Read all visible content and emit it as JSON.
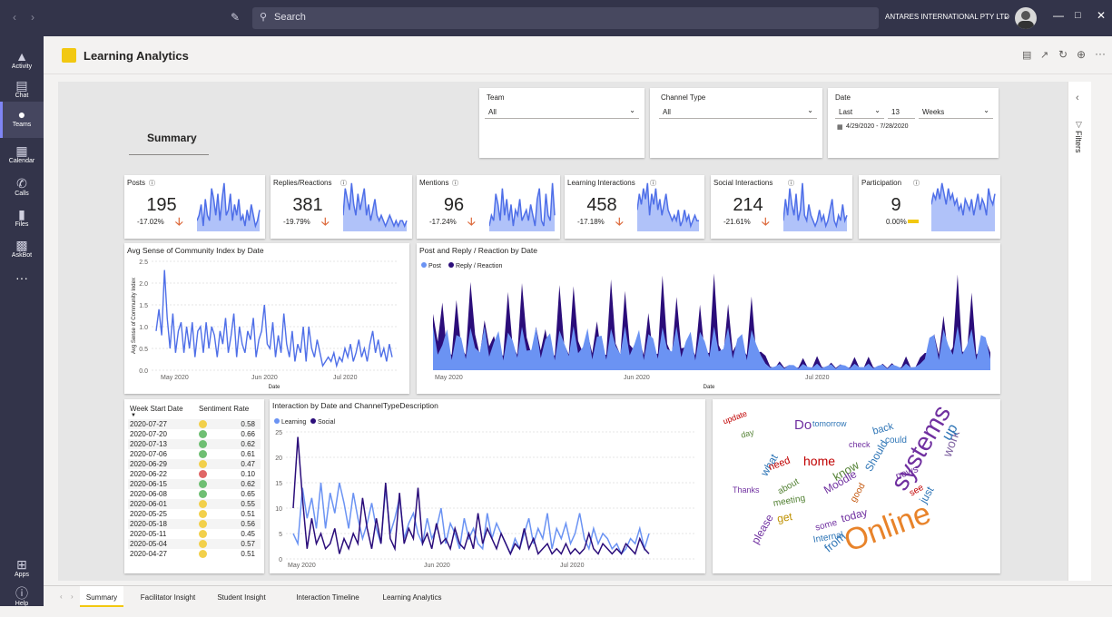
{
  "topbar": {
    "search_placeholder": "Search",
    "org": "ANTARES INTERNATIONAL PTY LTD"
  },
  "rail": [
    {
      "label": "Activity",
      "icon": "bell-icon"
    },
    {
      "label": "Chat",
      "icon": "chat-icon"
    },
    {
      "label": "Teams",
      "icon": "teams-icon"
    },
    {
      "label": "Calendar",
      "icon": "calendar-icon"
    },
    {
      "label": "Calls",
      "icon": "phone-icon"
    },
    {
      "label": "Files",
      "icon": "files-icon"
    },
    {
      "label": "AskBot",
      "icon": "bot-icon"
    }
  ],
  "rail_bottom": {
    "apps": "Apps",
    "help": "Help"
  },
  "app": {
    "title": "Learning Analytics"
  },
  "report": {
    "summary_title": "Summary",
    "filters_label": "Filters",
    "slicers": {
      "team": {
        "label": "Team",
        "value": "All"
      },
      "channel": {
        "label": "Channel Type",
        "value": "All"
      },
      "date": {
        "label": "Date",
        "period": "Last",
        "count": "13",
        "unit": "Weeks",
        "range": "4/29/2020 - 7/28/2020"
      }
    },
    "kpis": [
      {
        "title": "Posts",
        "value": "195",
        "change": "-17.02%",
        "trend": "down"
      },
      {
        "title": "Replies/Reactions",
        "value": "381",
        "change": "-19.79%",
        "trend": "down"
      },
      {
        "title": "Mentions",
        "value": "96",
        "change": "-17.24%",
        "trend": "down"
      },
      {
        "title": "Learning Interactions",
        "value": "458",
        "change": "-17.18%",
        "trend": "down"
      },
      {
        "title": "Social Interactions",
        "value": "214",
        "change": "-21.61%",
        "trend": "down"
      },
      {
        "title": "Participation",
        "value": "9",
        "change": "0.00%",
        "trend": "flat"
      }
    ],
    "sentiment_table": {
      "headers": [
        "Week Start Date",
        "Sentiment Rate"
      ],
      "rows": [
        {
          "date": "2020-07-27",
          "rate": "0.58",
          "status": "yellow"
        },
        {
          "date": "2020-07-20",
          "rate": "0.66",
          "status": "green"
        },
        {
          "date": "2020-07-13",
          "rate": "0.62",
          "status": "green"
        },
        {
          "date": "2020-07-06",
          "rate": "0.61",
          "status": "green"
        },
        {
          "date": "2020-06-29",
          "rate": "0.47",
          "status": "yellow"
        },
        {
          "date": "2020-06-22",
          "rate": "0.10",
          "status": "red"
        },
        {
          "date": "2020-06-15",
          "rate": "0.62",
          "status": "green"
        },
        {
          "date": "2020-06-08",
          "rate": "0.65",
          "status": "green"
        },
        {
          "date": "2020-06-01",
          "rate": "0.55",
          "status": "yellow"
        },
        {
          "date": "2020-05-25",
          "rate": "0.51",
          "status": "yellow"
        },
        {
          "date": "2020-05-18",
          "rate": "0.56",
          "status": "yellow"
        },
        {
          "date": "2020-05-11",
          "rate": "0.45",
          "status": "yellow"
        },
        {
          "date": "2020-05-04",
          "rate": "0.57",
          "status": "yellow"
        },
        {
          "date": "2020-04-27",
          "rate": "0.51",
          "status": "yellow"
        }
      ]
    },
    "tabs": [
      "Summary",
      "Facilitator Insight",
      "Student Insight",
      "Interaction Timeline",
      "Learning Analytics"
    ],
    "wordcloud": [
      {
        "w": "Online",
        "c": "#e8832a"
      },
      {
        "w": "systems",
        "c": "#7030a0"
      },
      {
        "w": "work",
        "c": "#8064a2"
      },
      {
        "w": "from",
        "c": "#2e75b6"
      },
      {
        "w": "home",
        "c": "#c00000"
      },
      {
        "w": "know",
        "c": "#548235"
      },
      {
        "w": "Do",
        "c": "#7030a0"
      },
      {
        "w": "up",
        "c": "#2e75b6"
      },
      {
        "w": "Moodle",
        "c": "#7030a0"
      },
      {
        "w": "get",
        "c": "#bf9000"
      },
      {
        "w": "today",
        "c": "#7030a0"
      },
      {
        "w": "what",
        "c": "#2e75b6"
      },
      {
        "w": "please",
        "c": "#7030a0"
      },
      {
        "w": "need",
        "c": "#c00000"
      },
      {
        "w": "just",
        "c": "#2e75b6"
      },
      {
        "w": "some",
        "c": "#7030a0"
      },
      {
        "w": "meeting",
        "c": "#548235"
      },
      {
        "w": "back",
        "c": "#2e75b6"
      },
      {
        "w": "news",
        "c": "#7030a0"
      },
      {
        "w": "Should",
        "c": "#2e75b6"
      },
      {
        "w": "could",
        "c": "#2e75b6"
      },
      {
        "w": "good",
        "c": "#c55a11"
      },
      {
        "w": "about",
        "c": "#548235"
      },
      {
        "w": "Internal",
        "c": "#2e75b6"
      },
      {
        "w": "update",
        "c": "#c00000"
      },
      {
        "w": "check",
        "c": "#7030a0"
      },
      {
        "w": "tomorrow",
        "c": "#2e75b6"
      },
      {
        "w": "Thanks",
        "c": "#7030a0"
      },
      {
        "w": "see",
        "c": "#c00000"
      },
      {
        "w": "day",
        "c": "#548235"
      }
    ]
  },
  "chart_data": [
    {
      "type": "area",
      "id": "posts",
      "title": "Posts",
      "values": [
        2,
        3,
        5,
        1,
        6,
        3,
        2,
        8,
        6,
        3,
        7,
        2,
        6,
        9,
        3,
        4,
        7,
        2,
        5,
        3,
        6,
        2,
        3,
        1,
        4,
        2,
        5,
        3,
        1,
        2,
        4
      ]
    },
    {
      "type": "area",
      "id": "replies",
      "title": "Replies/Reactions",
      "values": [
        3,
        8,
        6,
        4,
        9,
        5,
        3,
        7,
        4,
        6,
        8,
        3,
        5,
        2,
        4,
        6,
        3,
        2,
        3,
        2,
        1,
        2,
        3,
        2,
        1,
        2,
        1,
        2,
        2,
        1,
        2
      ]
    },
    {
      "type": "area",
      "id": "mentions",
      "title": "Mentions",
      "values": [
        1,
        3,
        2,
        7,
        5,
        2,
        8,
        3,
        6,
        2,
        5,
        1,
        4,
        3,
        6,
        2,
        3,
        4,
        2,
        5,
        3,
        1,
        6,
        8,
        2,
        1,
        7,
        3,
        2,
        9,
        3
      ]
    },
    {
      "type": "area",
      "id": "learning",
      "title": "Learning Interactions",
      "values": [
        4,
        7,
        5,
        8,
        6,
        9,
        3,
        7,
        5,
        8,
        4,
        6,
        3,
        5,
        7,
        4,
        3,
        2,
        3,
        2,
        4,
        1,
        2,
        4,
        2,
        3,
        1,
        2,
        3,
        2,
        2
      ]
    },
    {
      "type": "area",
      "id": "social",
      "title": "Social Interactions",
      "values": [
        2,
        6,
        3,
        8,
        5,
        3,
        7,
        2,
        4,
        9,
        3,
        2,
        5,
        3,
        2,
        1,
        2,
        4,
        2,
        3,
        1,
        2,
        4,
        6,
        2,
        1,
        3,
        2,
        5,
        2,
        3
      ]
    },
    {
      "type": "area",
      "id": "participation",
      "title": "Participation",
      "values": [
        5,
        7,
        6,
        8,
        6,
        9,
        7,
        5,
        8,
        6,
        7,
        5,
        6,
        4,
        5,
        3,
        6,
        5,
        4,
        6,
        3,
        5,
        7,
        4,
        6,
        5,
        3,
        8,
        6,
        5,
        7
      ]
    },
    {
      "type": "line",
      "id": "community",
      "title": "Avg Sense of Community Index by Date",
      "xlabel": "Date",
      "ylabel": "Avg Sense of Community Index",
      "ylim": [
        0,
        2.5
      ],
      "yticks": [
        "0.0",
        "0.5",
        "1.0",
        "1.5",
        "2.0",
        "2.5"
      ],
      "xticks": [
        "May 2020",
        "Jun 2020",
        "Jul 2020"
      ],
      "values": [
        0.9,
        1.4,
        0.8,
        2.3,
        1.2,
        0.5,
        1.3,
        0.4,
        0.9,
        1.1,
        0.4,
        1.0,
        0.5,
        1.1,
        0.3,
        0.9,
        1.0,
        0.4,
        1.1,
        0.5,
        1.0,
        0.8,
        0.3,
        0.9,
        0.6,
        1.2,
        0.4,
        0.8,
        1.3,
        0.3,
        1.0,
        0.6,
        0.4,
        0.9,
        0.7,
        1.2,
        0.3,
        0.7,
        0.9,
        1.5,
        0.6,
        0.5,
        1.1,
        0.3,
        0.8,
        0.4,
        1.3,
        0.6,
        0.3,
        0.9,
        0.2,
        0.6,
        0.4,
        1.0,
        0.2,
        1.0,
        0.5,
        0.3,
        0.7,
        0.4,
        0.1,
        0.2,
        0.3,
        0.2,
        0.4,
        0.1,
        0.3,
        0.2,
        0.5,
        0.3,
        0.6,
        0.2,
        0.4,
        0.7,
        0.3,
        0.5,
        0.2,
        0.6,
        0.9,
        0.4,
        0.7,
        0.3,
        0.5,
        0.2,
        0.6,
        0.3
      ]
    },
    {
      "type": "area",
      "id": "postreply",
      "title": "Post and Reply / Reaction by Date",
      "xlabel": "Date",
      "xticks": [
        "May 2020",
        "Jun 2020",
        "Jul 2020"
      ],
      "series": [
        {
          "name": "Post",
          "color": "#6b93f3"
        },
        {
          "name": "Reply / Reaction",
          "color": "#2b0d7a"
        }
      ]
    },
    {
      "type": "line",
      "id": "interaction",
      "title": "Interaction by Date and ChannelTypeDescription",
      "ylim": [
        0,
        25
      ],
      "yticks": [
        "0",
        "5",
        "10",
        "15",
        "20",
        "25"
      ],
      "xticks": [
        "May 2020",
        "Jun 2020",
        "Jul 2020"
      ],
      "series": [
        {
          "name": "Learning",
          "color": "#6b93f3",
          "values": [
            5,
            3,
            14,
            8,
            12,
            6,
            15,
            6,
            13,
            9,
            15,
            11,
            6,
            13,
            8,
            4,
            7,
            11,
            6,
            3,
            14,
            5,
            8,
            12,
            4,
            7,
            9,
            5,
            3,
            8,
            4,
            6,
            10,
            3,
            7,
            5,
            2,
            8,
            4,
            6,
            3,
            2,
            9,
            4,
            7,
            5,
            3,
            1,
            4,
            2,
            5,
            8,
            3,
            6,
            4,
            9,
            2,
            6,
            4,
            7,
            3,
            5,
            9,
            4,
            2,
            6,
            3,
            5,
            4,
            2,
            3,
            1,
            2,
            4,
            3,
            6,
            2,
            5
          ]
        },
        {
          "name": "Social",
          "color": "#2b0d7a",
          "values": [
            10,
            24,
            12,
            2,
            8,
            3,
            5,
            2,
            3,
            6,
            1,
            4,
            2,
            5,
            3,
            12,
            6,
            2,
            8,
            3,
            15,
            4,
            2,
            13,
            3,
            6,
            4,
            14,
            3,
            5,
            2,
            7,
            3,
            4,
            2,
            6,
            3,
            2,
            5,
            2,
            9,
            3,
            6,
            4,
            2,
            5,
            3,
            1,
            3,
            2,
            6,
            2,
            4,
            1,
            2,
            3,
            1,
            2,
            1,
            3,
            1,
            2,
            1,
            2,
            5,
            2,
            1,
            3,
            2,
            1,
            2,
            1,
            3,
            2,
            1,
            4,
            2,
            1
          ]
        }
      ]
    }
  ]
}
